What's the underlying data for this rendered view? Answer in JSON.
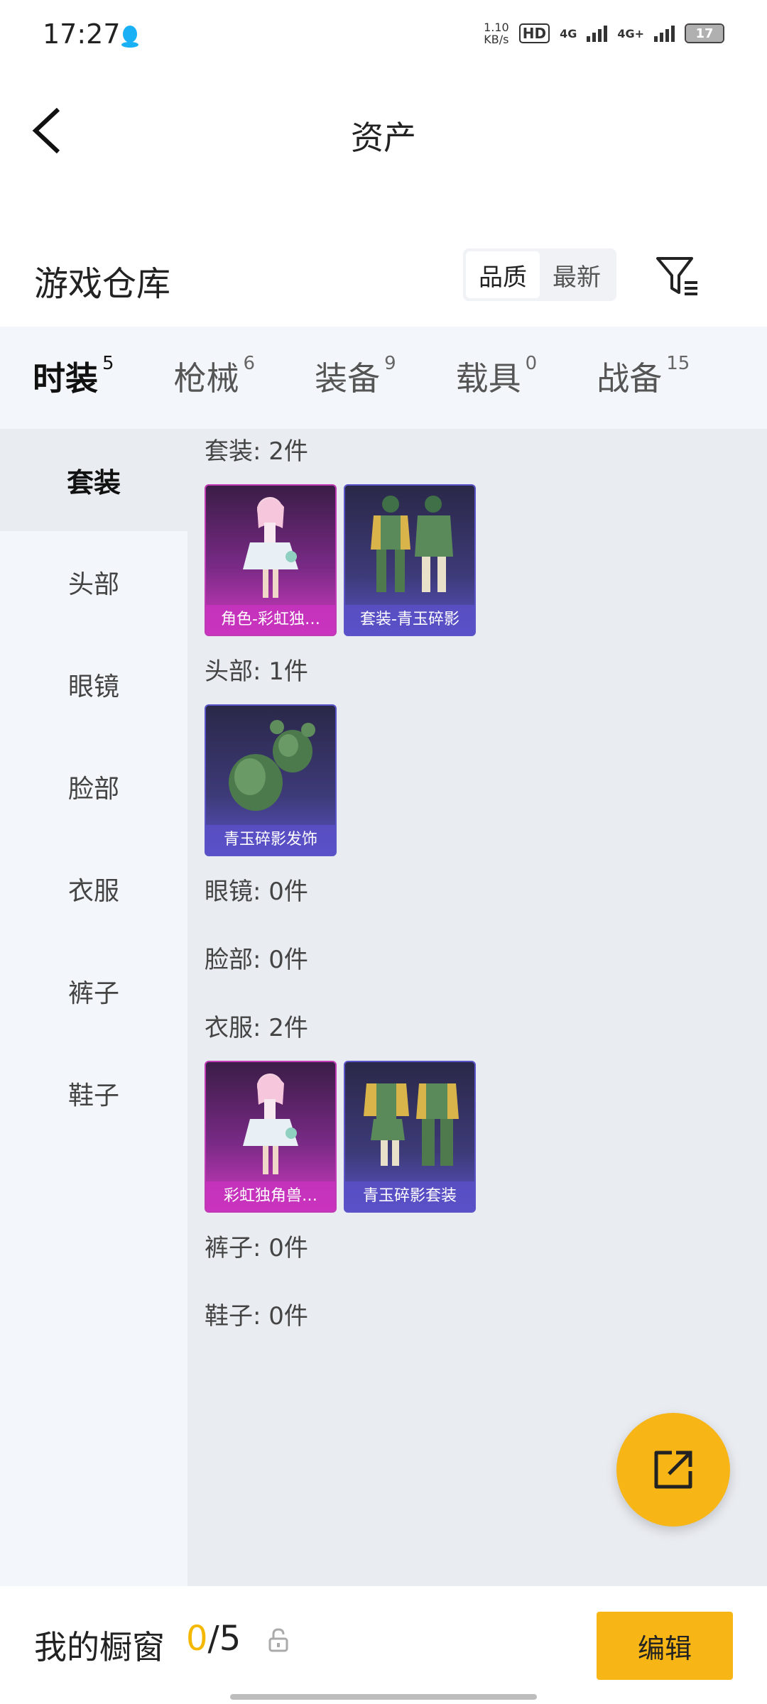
{
  "status_bar": {
    "time": "17:27",
    "net_speed_value": "1.10",
    "net_speed_unit": "KB/s",
    "hd_label": "HD",
    "sim1_label": "4G",
    "sim2_label": "4G+",
    "battery_level": "17",
    "battery_color": "#e53935"
  },
  "header": {
    "title": "资产"
  },
  "warehouse": {
    "title": "游戏仓库",
    "sort_options": [
      "品质",
      "最新"
    ],
    "sort_selected": "品质"
  },
  "tabs": [
    {
      "label": "时装",
      "count": "5",
      "active": true
    },
    {
      "label": "枪械",
      "count": "6",
      "active": false
    },
    {
      "label": "装备",
      "count": "9",
      "active": false
    },
    {
      "label": "载具",
      "count": "0",
      "active": false
    },
    {
      "label": "战备",
      "count": "15",
      "active": false
    }
  ],
  "side_nav": [
    {
      "label": "套装",
      "active": true
    },
    {
      "label": "头部",
      "active": false
    },
    {
      "label": "眼镜",
      "active": false
    },
    {
      "label": "脸部",
      "active": false
    },
    {
      "label": "衣服",
      "active": false
    },
    {
      "label": "裤子",
      "active": false
    },
    {
      "label": "鞋子",
      "active": false
    }
  ],
  "sections": [
    {
      "title": "套装: 2件",
      "items": [
        {
          "name": "角色-彩虹独角兽",
          "display": "角色-彩虹独…",
          "rarity": "pink",
          "icon": "character-figure"
        },
        {
          "name": "套装-青玉碎影",
          "display": "套装-青玉碎影",
          "rarity": "blue",
          "icon": "outfit-set"
        }
      ]
    },
    {
      "title": "头部: 1件",
      "items": [
        {
          "name": "青玉碎影发饰",
          "display": "青玉碎影发饰",
          "rarity": "blue",
          "icon": "hair-accessory"
        }
      ]
    },
    {
      "title": "眼镜: 0件",
      "items": []
    },
    {
      "title": "脸部: 0件",
      "items": []
    },
    {
      "title": "衣服: 2件",
      "items": [
        {
          "name": "彩虹独角兽",
          "display": "彩虹独角兽…",
          "rarity": "pink",
          "icon": "character-figure"
        },
        {
          "name": "青玉碎影套装",
          "display": "青玉碎影套装",
          "rarity": "blue",
          "icon": "outfit-set"
        }
      ]
    },
    {
      "title": "裤子: 0件",
      "items": []
    },
    {
      "title": "鞋子: 0件",
      "items": []
    }
  ],
  "bottom_bar": {
    "label": "我的橱窗",
    "current": "0",
    "separator": "/",
    "total": "5",
    "edit_label": "编辑"
  },
  "colors": {
    "accent": "#f7b516",
    "rarity_pink": "#c13ab5",
    "rarity_blue": "#5b54c8"
  }
}
